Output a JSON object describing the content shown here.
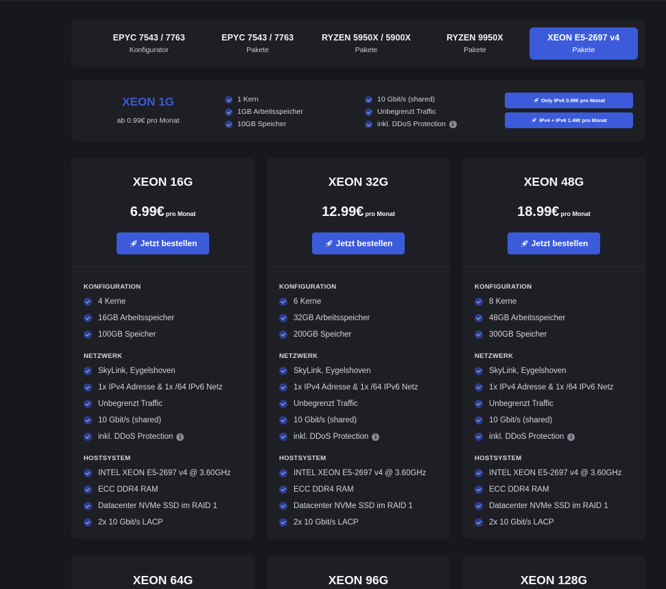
{
  "tabs": [
    {
      "title": "EPYC 7543 / 7763",
      "subtitle": "Konfigurator",
      "active": false
    },
    {
      "title": "EPYC 7543 / 7763",
      "subtitle": "Pakete",
      "active": false
    },
    {
      "title": "RYZEN 5950X / 5900X",
      "subtitle": "Pakete",
      "active": false
    },
    {
      "title": "RYZEN 9950X",
      "subtitle": "Pakete",
      "active": false
    },
    {
      "title": "XEON E5-2697 v4",
      "subtitle": "Pakete",
      "active": true
    }
  ],
  "mini_plan": {
    "title": "XEON 1G",
    "price": "ab 0.99€ pro Monat",
    "col1": [
      "1 Kern",
      "1GB Arbeitsspeicher",
      "10GB Speicher"
    ],
    "col2": [
      "10 Gbit/s (shared)",
      "Unbegrenzt Traffic",
      "inkl. DDoS Protection"
    ],
    "btn_ipv6": "Only IPv6 0.99€ pro Monat",
    "btn_ipv4": "IPv4 + IPv6 1.49€ pro Monat"
  },
  "labels": {
    "per_month": "pro Monat",
    "order": "Jetzt bestellen",
    "sec_config": "KONFIGURATION",
    "sec_network": "NETZWERK",
    "sec_host": "HOSTSYSTEM"
  },
  "plans": [
    {
      "name": "XEON 16G",
      "price": "6.99€",
      "config": [
        "4 Kerne",
        "16GB Arbeitsspeicher",
        "100GB Speicher"
      ],
      "network": [
        "SkyLink, Eygelshoven",
        "1x IPv4 Adresse & 1x /64 IPv6 Netz",
        "Unbegrenzt Traffic",
        "10 Gbit/s (shared)",
        "inkl. DDoS Protection"
      ],
      "host": [
        "INTEL XEON E5-2697 v4 @ 3.60GHz",
        "ECC DDR4 RAM",
        "Datacenter NVMe SSD im RAID 1",
        "2x 10 Gbit/s LACP"
      ]
    },
    {
      "name": "XEON 32G",
      "price": "12.99€",
      "config": [
        "6 Kerne",
        "32GB Arbeitsspeicher",
        "200GB Speicher"
      ],
      "network": [
        "SkyLink, Eygelshoven",
        "1x IPv4 Adresse & 1x /64 IPv6 Netz",
        "Unbegrenzt Traffic",
        "10 Gbit/s (shared)",
        "inkl. DDoS Protection"
      ],
      "host": [
        "INTEL XEON E5-2697 v4 @ 3.60GHz",
        "ECC DDR4 RAM",
        "Datacenter NVMe SSD im RAID 1",
        "2x 10 Gbit/s LACP"
      ]
    },
    {
      "name": "XEON 48G",
      "price": "18.99€",
      "config": [
        "8 Kerne",
        "48GB Arbeitsspeicher",
        "300GB Speicher"
      ],
      "network": [
        "SkyLink, Eygelshoven",
        "1x IPv4 Adresse & 1x /64 IPv6 Netz",
        "Unbegrenzt Traffic",
        "10 Gbit/s (shared)",
        "inkl. DDoS Protection"
      ],
      "host": [
        "INTEL XEON E5-2697 v4 @ 3.60GHz",
        "ECC DDR4 RAM",
        "Datacenter NVMe SSD im RAID 1",
        "2x 10 Gbit/s LACP"
      ]
    }
  ],
  "next_plans": [
    "XEON 64G",
    "XEON 96G",
    "XEON 128G"
  ],
  "colors": {
    "accent": "#3b5bdb",
    "background": "#17181d",
    "card": "#1e1f25"
  }
}
